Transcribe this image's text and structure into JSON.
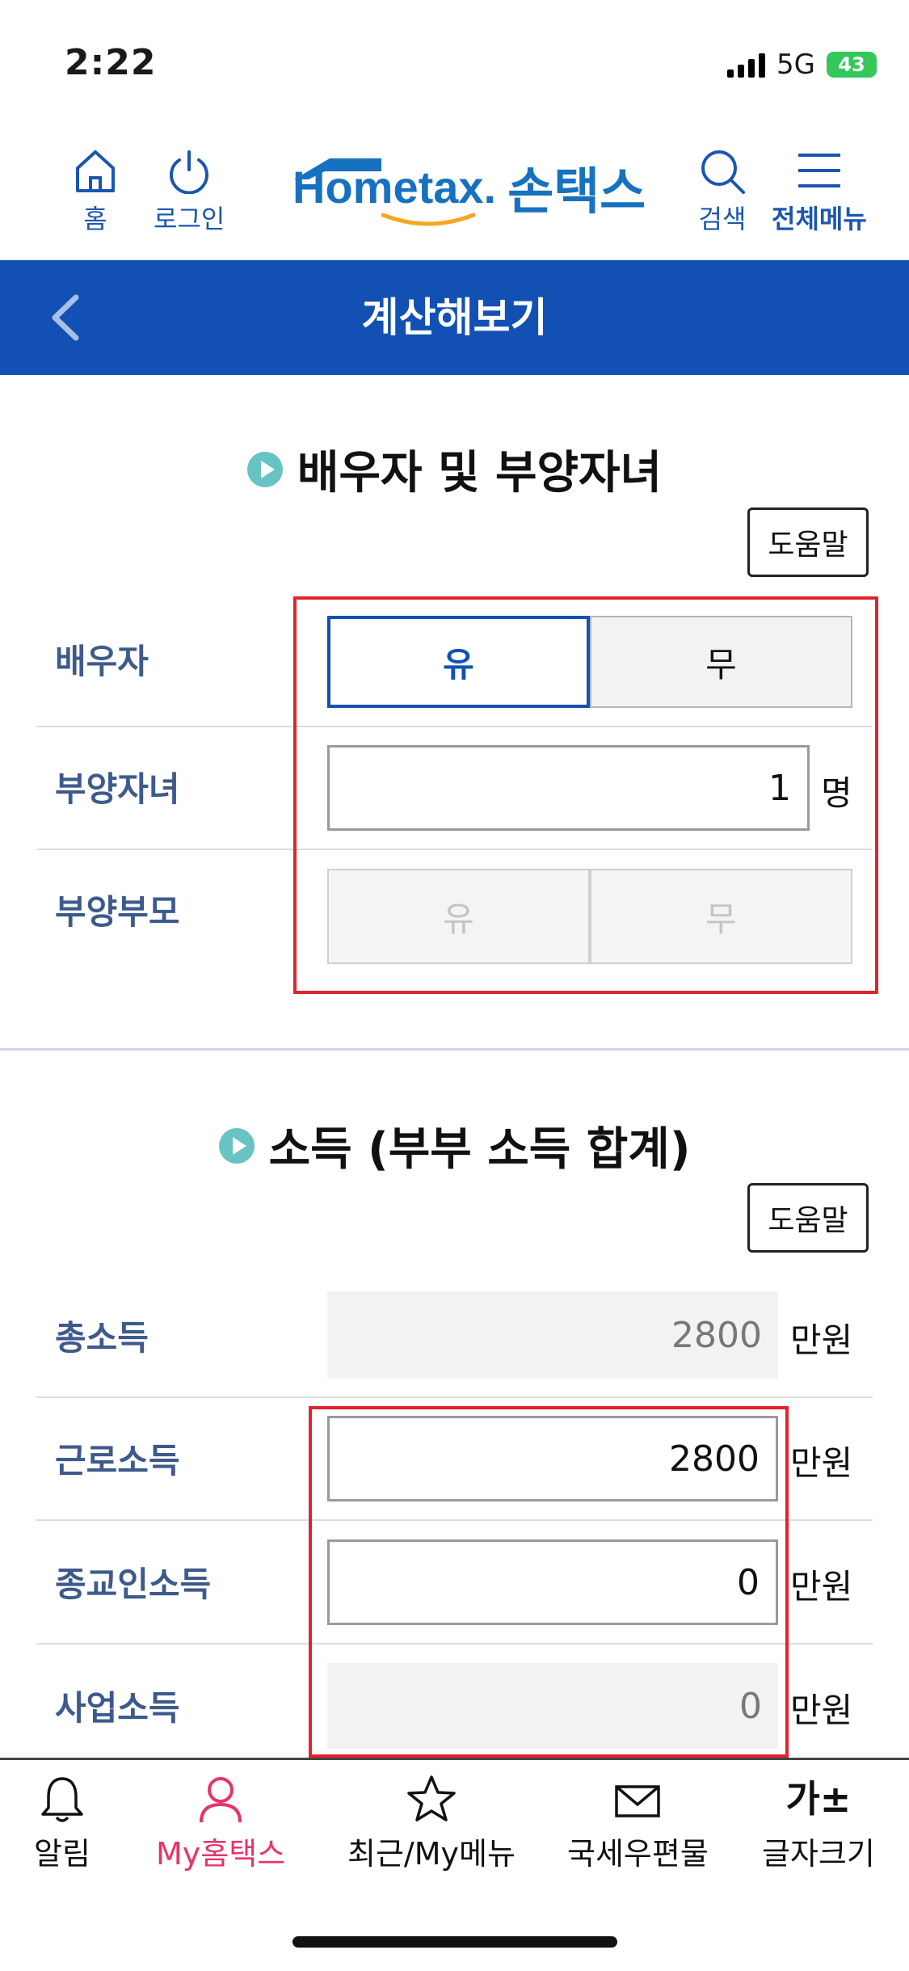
{
  "status": {
    "time": "2:22",
    "network": "5G",
    "battery": "43"
  },
  "topnav": {
    "home_label": "홈",
    "login_label": "로그인",
    "logo_text": "Hometax.",
    "logo_korean": "손택스",
    "search_label": "검색",
    "menu_label": "전체메뉴"
  },
  "header": {
    "title": "계산해보기"
  },
  "section1": {
    "title": "배우자 및 부양자녀",
    "help_label": "도움말",
    "spouse": {
      "label": "배우자",
      "yes": "유",
      "no": "무",
      "selected": "유"
    },
    "children": {
      "label": "부양자녀",
      "value": "1",
      "unit": "명"
    },
    "parents": {
      "label": "부양부모",
      "yes": "유",
      "no": "무"
    }
  },
  "section2": {
    "title": "소득 (부부 소득 합계)",
    "help_label": "도움말",
    "rows": [
      {
        "label": "총소득",
        "value": "2800",
        "unit": "만원"
      },
      {
        "label": "근로소득",
        "value": "2800",
        "unit": "만원"
      },
      {
        "label": "종교인소득",
        "value": "0",
        "unit": "만원"
      },
      {
        "label": "사업소득",
        "value": "0",
        "unit": "만원"
      }
    ]
  },
  "tabbar": {
    "items": [
      {
        "label": "알림",
        "icon": "bell-icon"
      },
      {
        "label": "My홈택스",
        "icon": "person-icon",
        "active": true
      },
      {
        "label": "최근/My메뉴",
        "icon": "star-icon"
      },
      {
        "label": "국세우편물",
        "icon": "mail-icon"
      },
      {
        "label": "글자크기",
        "icon": "font-size-icon",
        "glyph": "가±"
      }
    ]
  },
  "colors": {
    "brand_blue": "#1251b3",
    "accent_pink": "#e8336a",
    "highlight_red": "#e0242c",
    "teal": "#68c3c3"
  }
}
